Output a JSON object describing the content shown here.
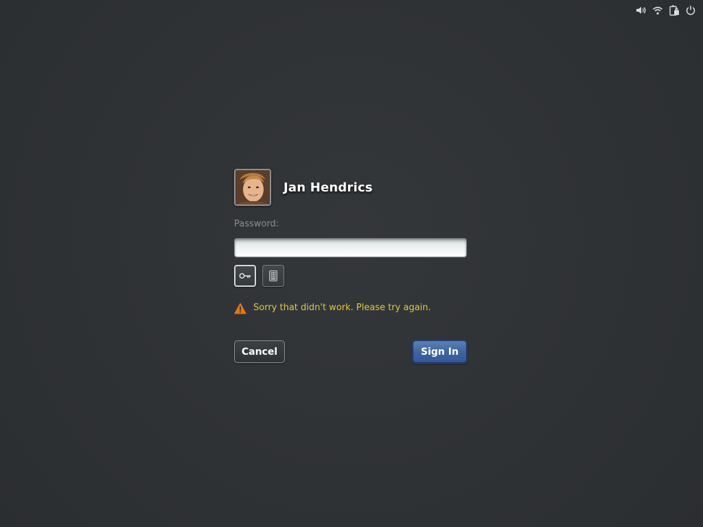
{
  "status_icons": [
    {
      "name": "volume-icon"
    },
    {
      "name": "wifi-icon"
    },
    {
      "name": "battery-icon"
    },
    {
      "name": "power-icon"
    }
  ],
  "user": {
    "name": "Jan Hendrics",
    "avatar_icon": "user-avatar-photo"
  },
  "password": {
    "label": "Password:",
    "value": "",
    "placeholder": ""
  },
  "auth_methods": [
    {
      "icon": "key-icon",
      "selected": true
    },
    {
      "icon": "smartcard-icon",
      "selected": false
    }
  ],
  "error": {
    "icon": "warning-icon",
    "message": "Sorry that didn't work. Please try again.",
    "color": "#e1c83a"
  },
  "actions": {
    "cancel_label": "Cancel",
    "signin_label": "Sign In",
    "signin_color": "#3e63a0"
  }
}
